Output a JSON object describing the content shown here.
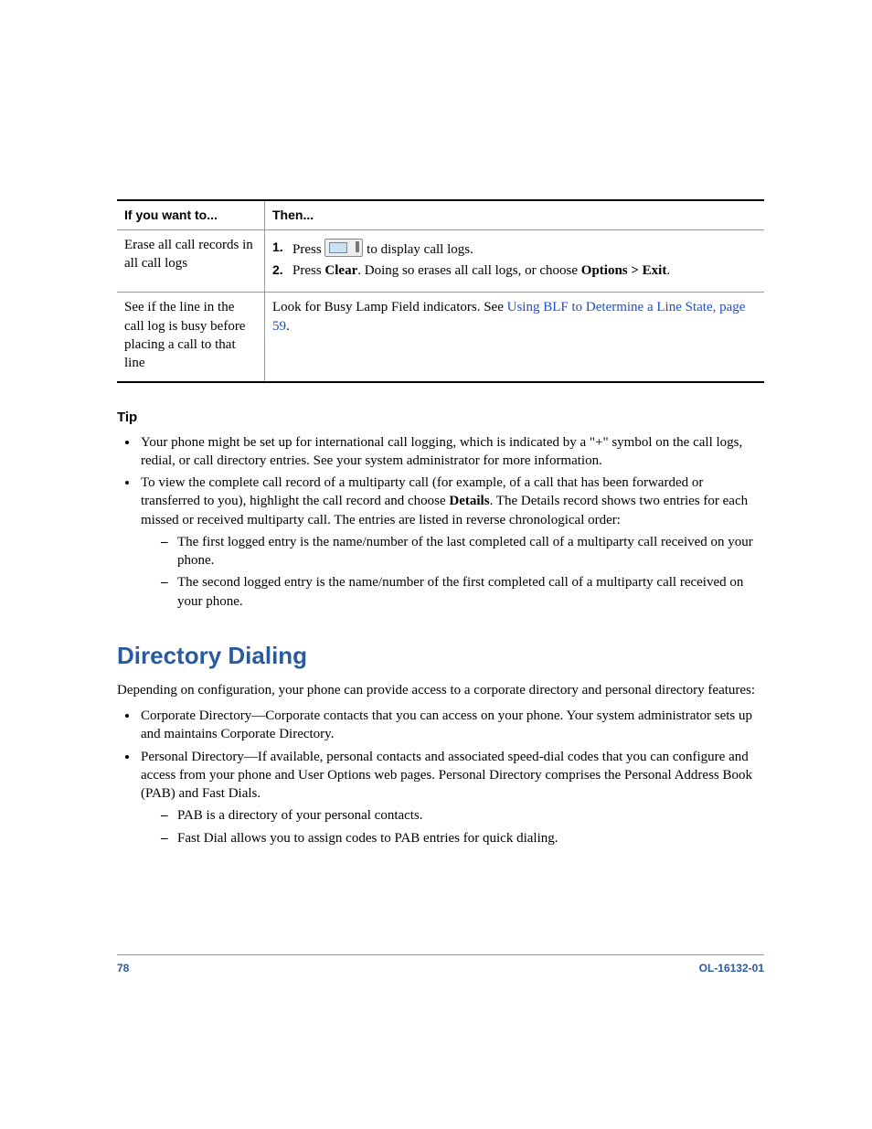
{
  "table": {
    "headers": [
      "If you want to...",
      "Then..."
    ],
    "rows": [
      {
        "want": "Erase all call records in all call logs",
        "step1_a": "Press ",
        "step1_b": " to display call logs.",
        "step2_a": "Press ",
        "step2_clear": "Clear",
        "step2_b": ". Doing so erases all call logs, or choose ",
        "step2_opt": "Options > Exit",
        "step2_c": "."
      },
      {
        "want": "See if the line in the call log is busy before placing a call to that line",
        "then_a": "Look for Busy Lamp Field indicators. See ",
        "then_link": "Using BLF to Determine a Line State, page 59",
        "then_b": "."
      }
    ]
  },
  "tip": {
    "heading": "Tip",
    "items": [
      "Your phone might be set up for international call logging, which is indicated by a \"+\" symbol on the call logs, redial, or call directory entries. See your system administrator for more information.",
      {
        "text_a": "To view the complete call record of a multiparty call (for example, of a call that has been forwarded or transferred to you), highlight the call record and choose ",
        "bold": "Details",
        "text_b": ". The Details record shows two entries for each missed or received multiparty call. The entries are listed in reverse chronological order:",
        "sub": [
          "The first logged entry is the name/number of the last completed call of a multiparty call received on your phone.",
          "The second logged entry is the name/number of the first completed call of a multiparty call received on your phone."
        ]
      }
    ]
  },
  "section": {
    "title": "Directory Dialing",
    "intro": "Depending on configuration, your phone can provide access to a corporate directory and personal directory features:",
    "bullets": [
      "Corporate Directory—Corporate contacts that you can access on your phone. Your system administrator sets up and maintains Corporate Directory.",
      {
        "text": "Personal Directory—If available, personal contacts and associated speed-dial codes that you can configure and access from your phone and User Options web pages. Personal Directory comprises the Personal Address Book (PAB) and Fast Dials.",
        "sub": [
          "PAB is a directory of your personal contacts.",
          "Fast Dial allows you to assign codes to PAB entries for quick dialing."
        ]
      }
    ]
  },
  "footer": {
    "page": "78",
    "docid": "OL-16132-01"
  }
}
